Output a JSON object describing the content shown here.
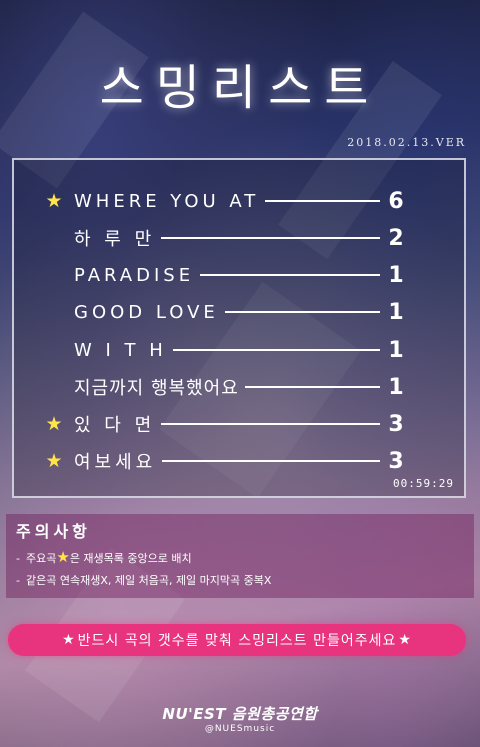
{
  "title": "스밍리스트",
  "version": "2018.02.13.VER",
  "playlist": {
    "items": [
      {
        "name": "WHERE YOU AT",
        "count": "6",
        "featured": true
      },
      {
        "name": "하 루 만",
        "count": "2",
        "featured": false
      },
      {
        "name": "PARADISE",
        "count": "1",
        "featured": false
      },
      {
        "name": "GOOD LOVE",
        "count": "1",
        "featured": false
      },
      {
        "name": "W I T H",
        "count": "1",
        "featured": false
      },
      {
        "name": "지금까지 행복했어요",
        "count": "1",
        "featured": false
      },
      {
        "name": "있 다 면",
        "count": "3",
        "featured": true
      },
      {
        "name": "여보세요",
        "count": "3",
        "featured": true
      }
    ],
    "total_duration": "00:59:29",
    "star_icon": "star-icon",
    "star_color": "#ffe44a"
  },
  "notes": {
    "title": "주의사항",
    "line1_a": "주요곡",
    "line1_b": "은 재생목록 중앙으로 배치",
    "line2": "같은곡 연속재생X, 제일 처음곡, 제일 마지막곡 중복X"
  },
  "banner": {
    "text": "반드시 곡의 갯수를 맞춰 스밍리스트 만들어주세요",
    "color": "#e8337e"
  },
  "logo": {
    "brand": "NU'EST 음원총공연합",
    "handle": "@NUESmusic"
  }
}
